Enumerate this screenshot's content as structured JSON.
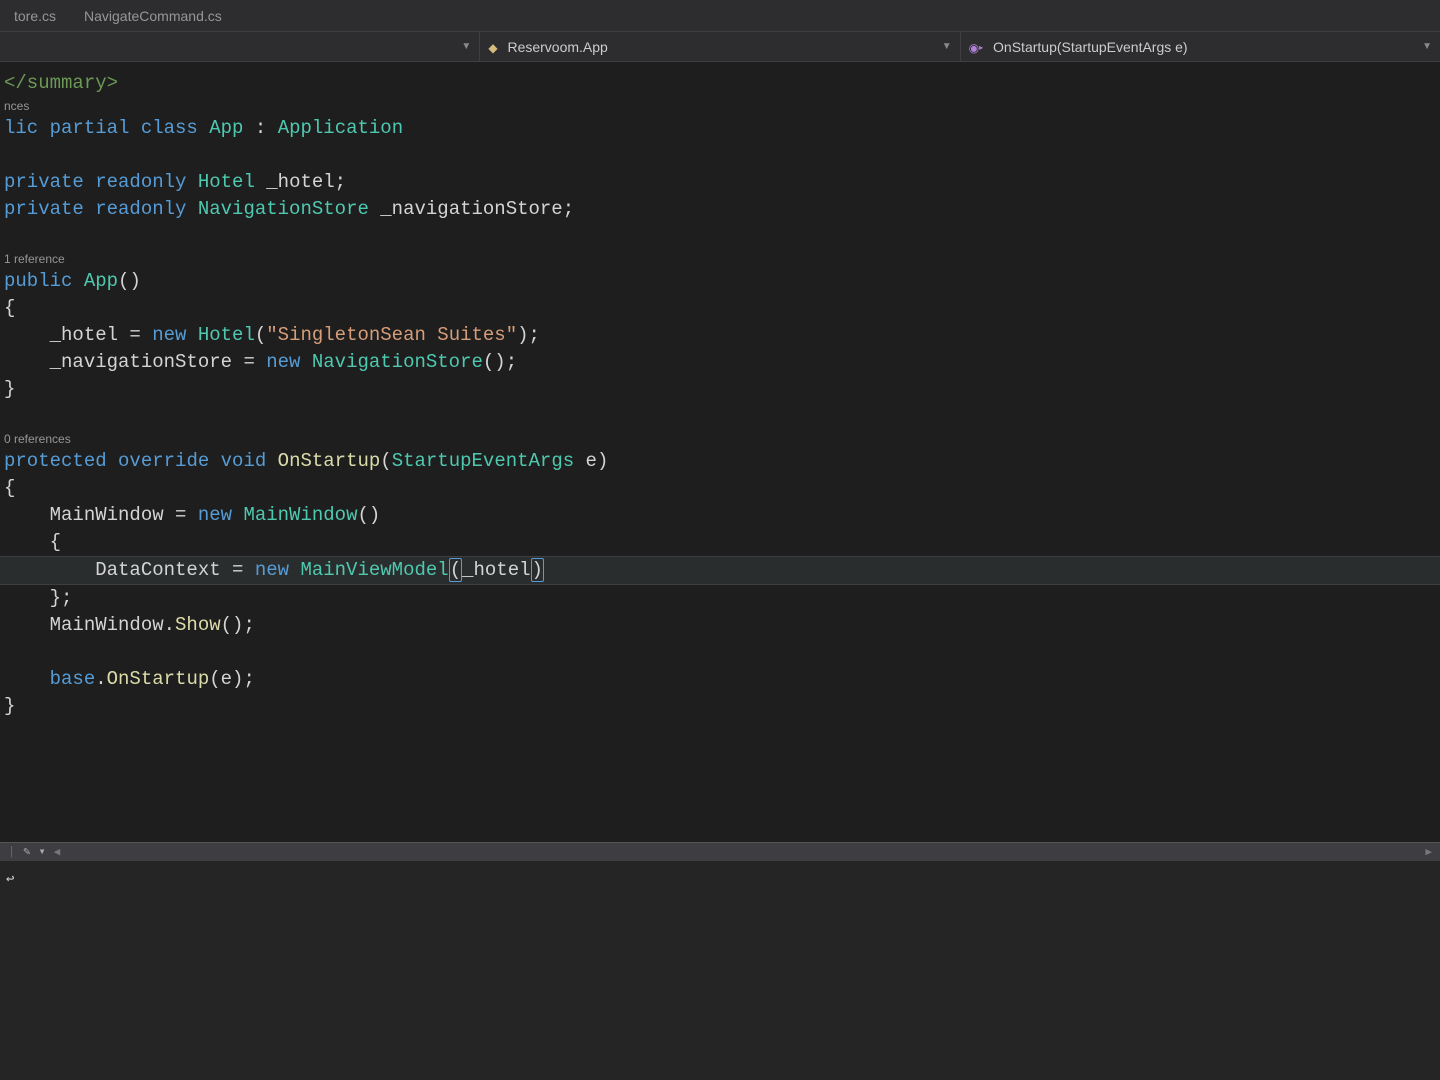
{
  "tabs": [
    {
      "label": "tore.cs"
    },
    {
      "label": "NavigateCommand.cs"
    }
  ],
  "nav": {
    "left": "",
    "mid": "Reservoom.App",
    "right": "OnStartup(StartupEventArgs e)"
  },
  "code": {
    "l1": "</summary>",
    "l2_ref": "nces",
    "l3_p1": "lic ",
    "l3_p2": "partial ",
    "l3_p3": "class ",
    "l3_type": "App",
    "l3_p4": " : ",
    "l3_base": "Application",
    "l5_p1": "private ",
    "l5_p2": "readonly ",
    "l5_type": "Hotel",
    "l5_p3": " _hotel;",
    "l6_p1": "private ",
    "l6_p2": "readonly ",
    "l6_type": "NavigationStore",
    "l6_p3": " _navigationStore;",
    "l8_ref": "1 reference",
    "l9_p1": "public ",
    "l9_m": "App",
    "l9_p2": "()",
    "l10": "{",
    "l11_p1": "    _hotel = ",
    "l11_kw": "new ",
    "l11_type": "Hotel",
    "l11_p2": "(",
    "l11_str": "\"SingletonSean Suites\"",
    "l11_p3": ");",
    "l12_p1": "    _navigationStore = ",
    "l12_kw": "new ",
    "l12_type": "NavigationStore",
    "l12_p2": "();",
    "l13": "}",
    "l15_ref": "0 references",
    "l16_p1": "protected ",
    "l16_p2": "override ",
    "l16_p3": "void ",
    "l16_m": "OnStartup",
    "l16_p4": "(",
    "l16_type": "StartupEventArgs",
    "l16_p5": " e)",
    "l17": "{",
    "l18_p1": "    MainWindow = ",
    "l18_kw": "new ",
    "l18_type": "MainWindow",
    "l18_p2": "()",
    "l19": "    {",
    "l20_p1": "        DataContext = ",
    "l20_kw": "new ",
    "l20_type": "MainViewModel",
    "l20_paren_l": "(",
    "l20_arg": "_hotel",
    "l20_paren_r": ")",
    "l21": "    };",
    "l22_p1": "    MainWindow.",
    "l22_m": "Show",
    "l22_p2": "();",
    "l24_p1": "    ",
    "l24_kw": "base",
    "l24_p2": ".",
    "l24_m": "OnStartup",
    "l24_p3": "(e);",
    "l25": "}"
  }
}
